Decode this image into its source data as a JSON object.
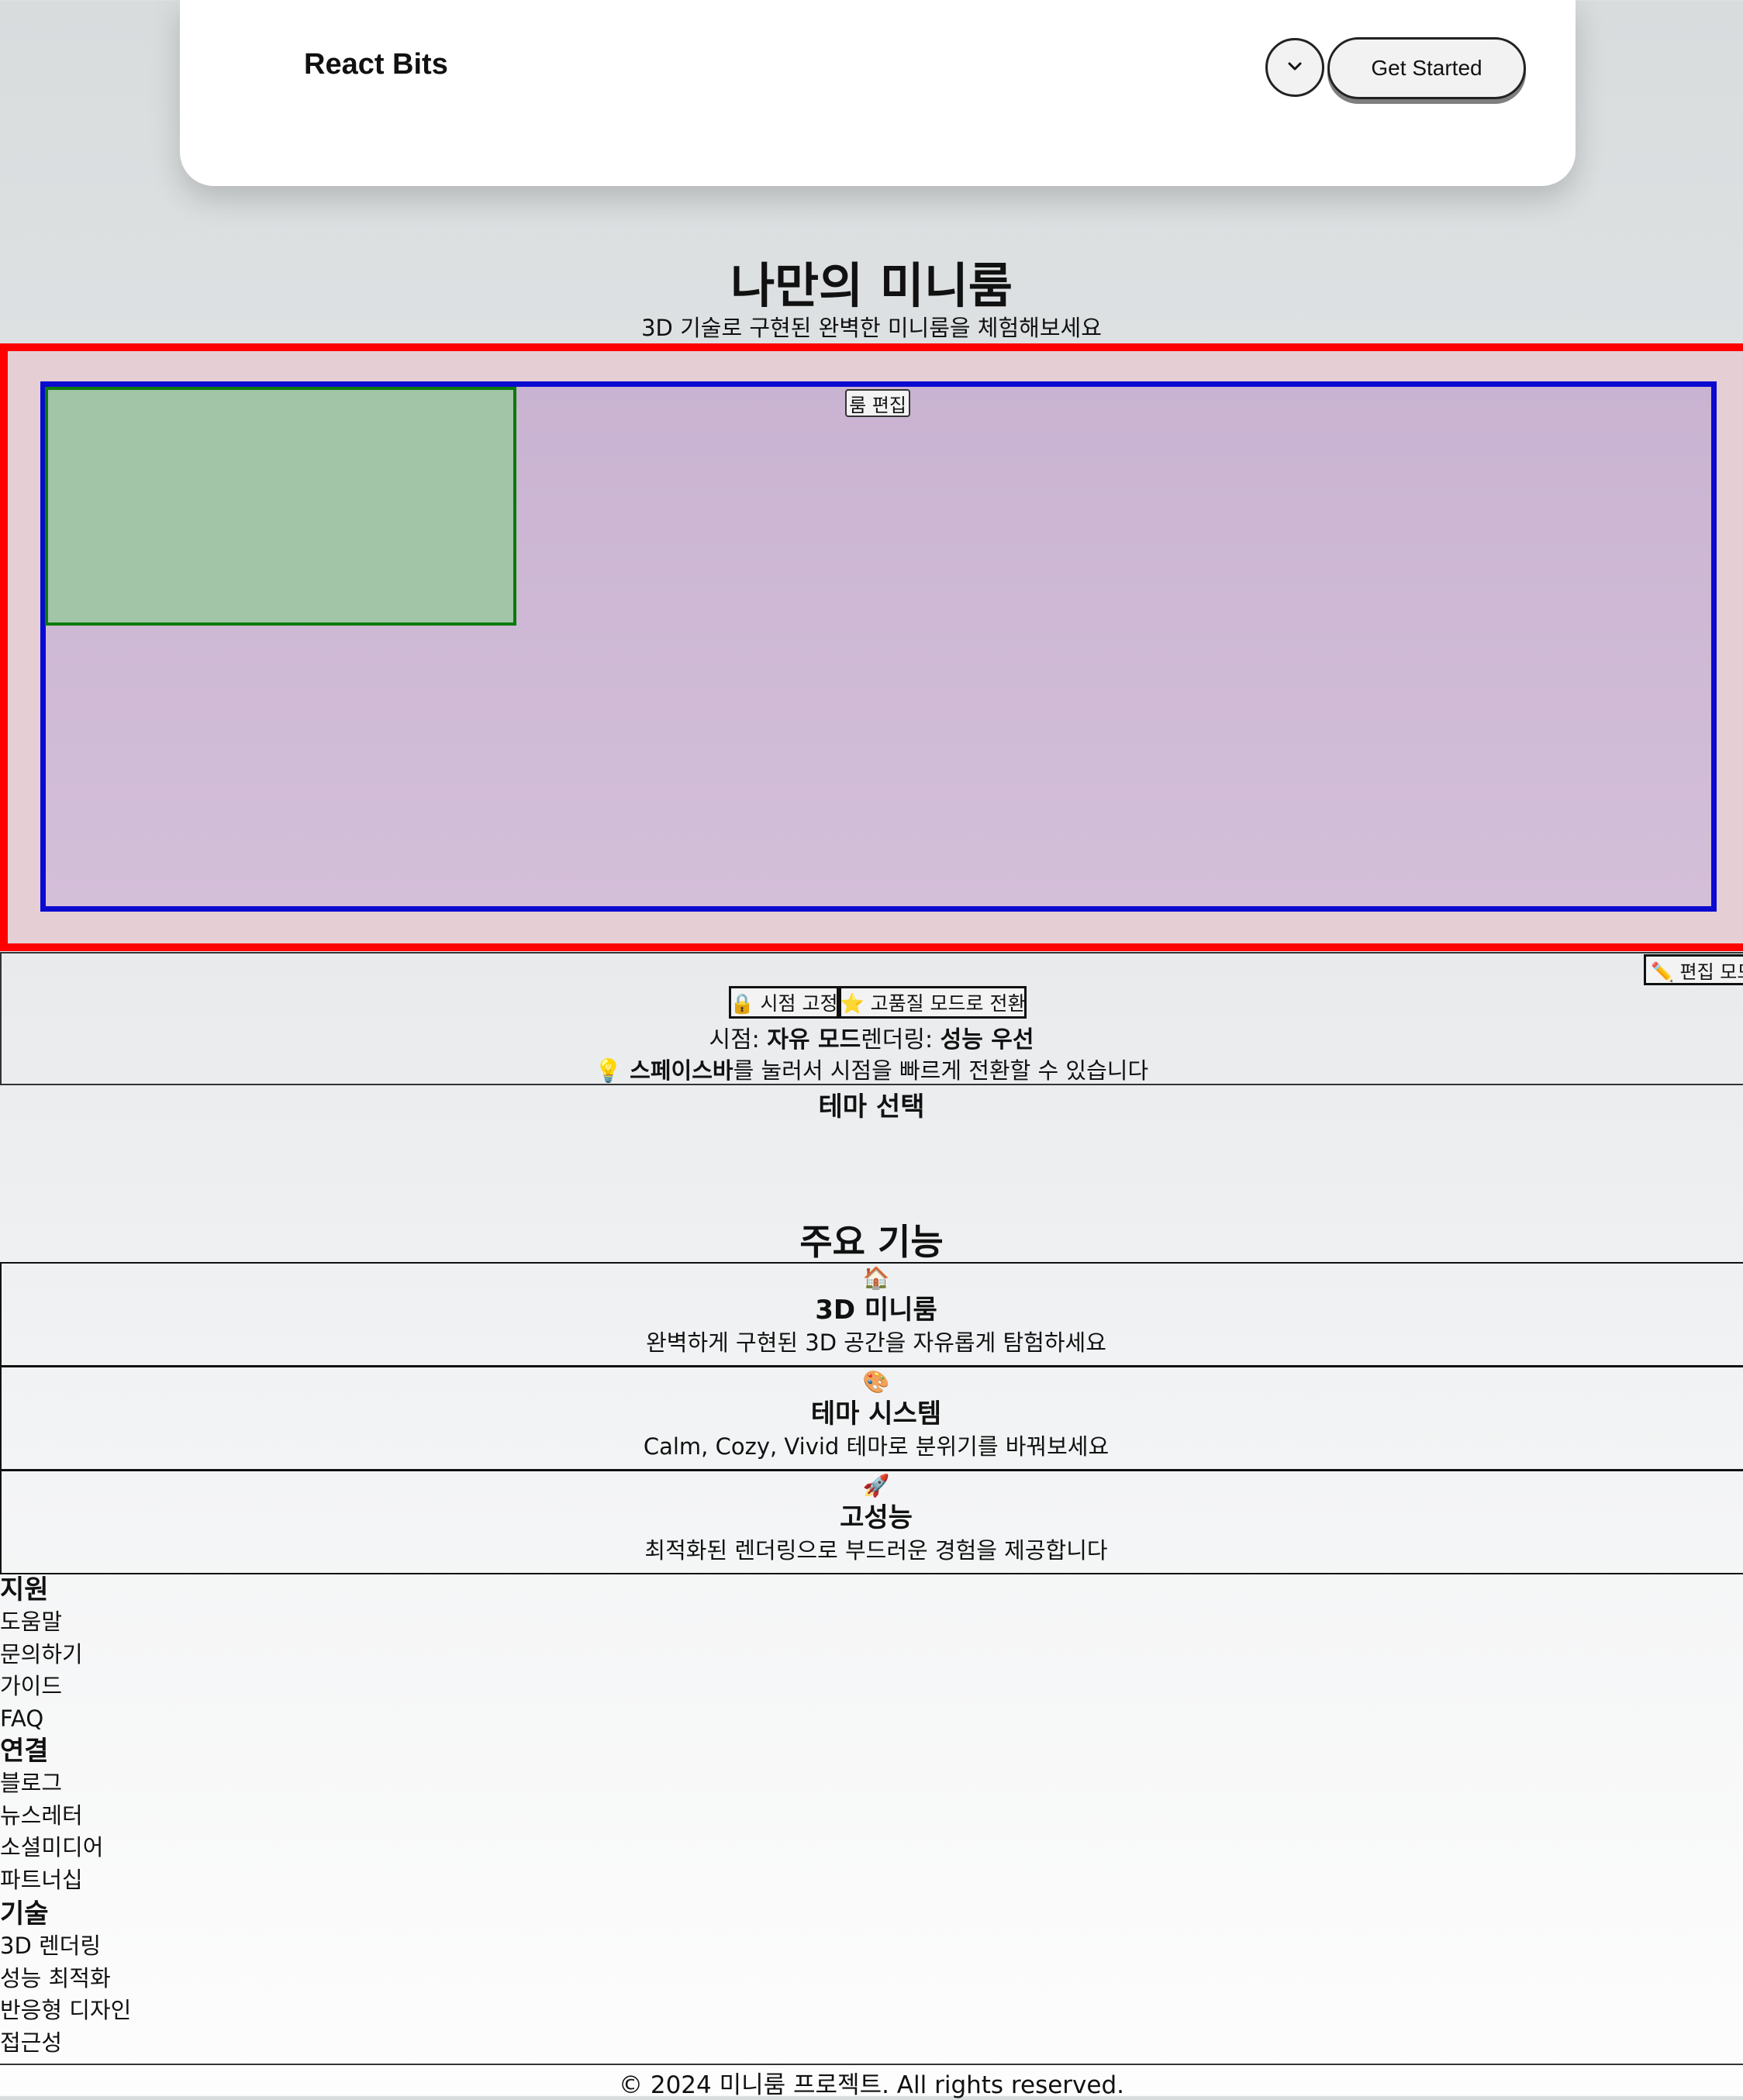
{
  "header": {
    "brand": "React Bits",
    "cta_label": "Get Started",
    "menu_icon": "chevron-down-icon"
  },
  "hero": {
    "title": "나만의 미니룸",
    "subtitle": "3D 기술로 구현된 완벽한 미니룸을 체험해보세요"
  },
  "viewer": {
    "room_edit_label": "룸 편집",
    "edit_mode_label": "✏️ 편집 모드",
    "frame_colors": {
      "outer": "#ff0000",
      "inner": "#0a0ad0",
      "object": "#0c7a0c"
    }
  },
  "controls": {
    "view_lock_label": "🔒 시점 고정",
    "hq_label": "⭐ 고품질 모드로 전환",
    "status": {
      "view_prefix": "시점: ",
      "view_value": "자유 모드",
      "render_prefix": "렌더링: ",
      "render_value": "성능 우선"
    },
    "tip": {
      "icon": "💡",
      "key": "스페이스바",
      "rest": "를 눌러서 시점을 빠르게 전환할 수 있습니다"
    }
  },
  "theme_section": {
    "title": "테마 선택"
  },
  "features": {
    "title": "주요 기능",
    "items": [
      {
        "icon": "🏠",
        "title": "3D 미니룸",
        "desc": "완벽하게 구현된 3D 공간을 자유롭게 탐험하세요"
      },
      {
        "icon": "🎨",
        "title": "테마 시스템",
        "desc": "Calm, Cozy, Vivid 테마로 분위기를 바꿔보세요"
      },
      {
        "icon": "🚀",
        "title": "고성능",
        "desc": "최적화된 렌더링으로 부드러운 경험을 제공합니다"
      }
    ]
  },
  "footer": {
    "columns": [
      {
        "title": "지원",
        "links": [
          "도움말",
          "문의하기",
          "가이드",
          "FAQ"
        ]
      },
      {
        "title": "연결",
        "links": [
          "블로그",
          "뉴스레터",
          "소셜미디어",
          "파트너십"
        ]
      },
      {
        "title": "기술",
        "links": [
          "3D 렌더링",
          "성능 최적화",
          "반응형 디자인",
          "접근성"
        ]
      }
    ],
    "copyright": "© 2024 미니룸 프로젝트. All rights reserved."
  }
}
